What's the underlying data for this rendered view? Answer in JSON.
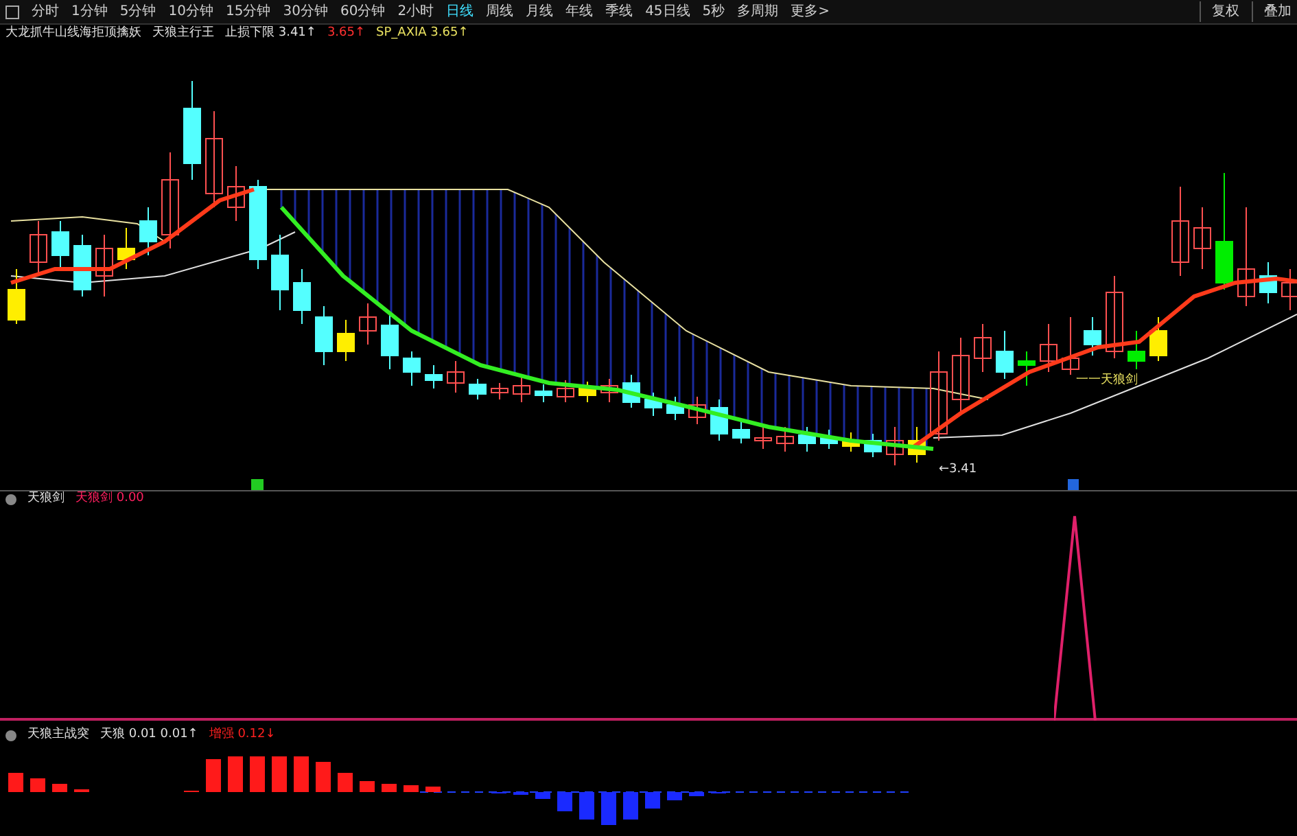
{
  "toolbar": {
    "items": [
      {
        "label": "分时",
        "selected": false
      },
      {
        "label": "1分钟",
        "selected": false
      },
      {
        "label": "5分钟",
        "selected": false
      },
      {
        "label": "10分钟",
        "selected": false
      },
      {
        "label": "15分钟",
        "selected": false
      },
      {
        "label": "30分钟",
        "selected": false
      },
      {
        "label": "60分钟",
        "selected": false
      },
      {
        "label": "2小时",
        "selected": false
      },
      {
        "label": "日线",
        "selected": true
      },
      {
        "label": "周线",
        "selected": false
      },
      {
        "label": "月线",
        "selected": false
      },
      {
        "label": "年线",
        "selected": false
      },
      {
        "label": "季线",
        "selected": false
      },
      {
        "label": "45日线",
        "selected": false
      },
      {
        "label": "5秒",
        "selected": false
      },
      {
        "label": "多周期",
        "selected": false
      },
      {
        "label": "更多>",
        "selected": false
      }
    ],
    "right_buttons": [
      "复权",
      "叠加"
    ]
  },
  "main_panel": {
    "legend": [
      {
        "text": "大龙抓牛山线海拒顶擒妖",
        "color": "#e0e0e0"
      },
      {
        "text": "天狼主行王",
        "color": "#e0e0e0"
      },
      {
        "text": "止损下限 3.41↑",
        "color": "#e0e0e0"
      },
      {
        "text": "3.65↑",
        "color": "#ff3030"
      },
      {
        "text": "SP_AXIA 3.65↑",
        "color": "#e8e060"
      }
    ],
    "annotations": [
      {
        "text": "←3.41"
      },
      {
        "text": "一一天狼剑"
      }
    ]
  },
  "indicator_panel": {
    "legend": [
      {
        "text": "天狼剑",
        "color": "#e0e0e0"
      },
      {
        "text": "天狼剑 0.00",
        "color": "#ff2060"
      }
    ]
  },
  "oscillator_panel": {
    "legend": [
      {
        "text": "天狼主战突",
        "color": "#e0e0e0"
      },
      {
        "text": "天狼 0.01 0.01↑",
        "color": "#e0e0e0"
      },
      {
        "text": "增强 0.12↓",
        "color": "#ff2020"
      }
    ]
  }
}
